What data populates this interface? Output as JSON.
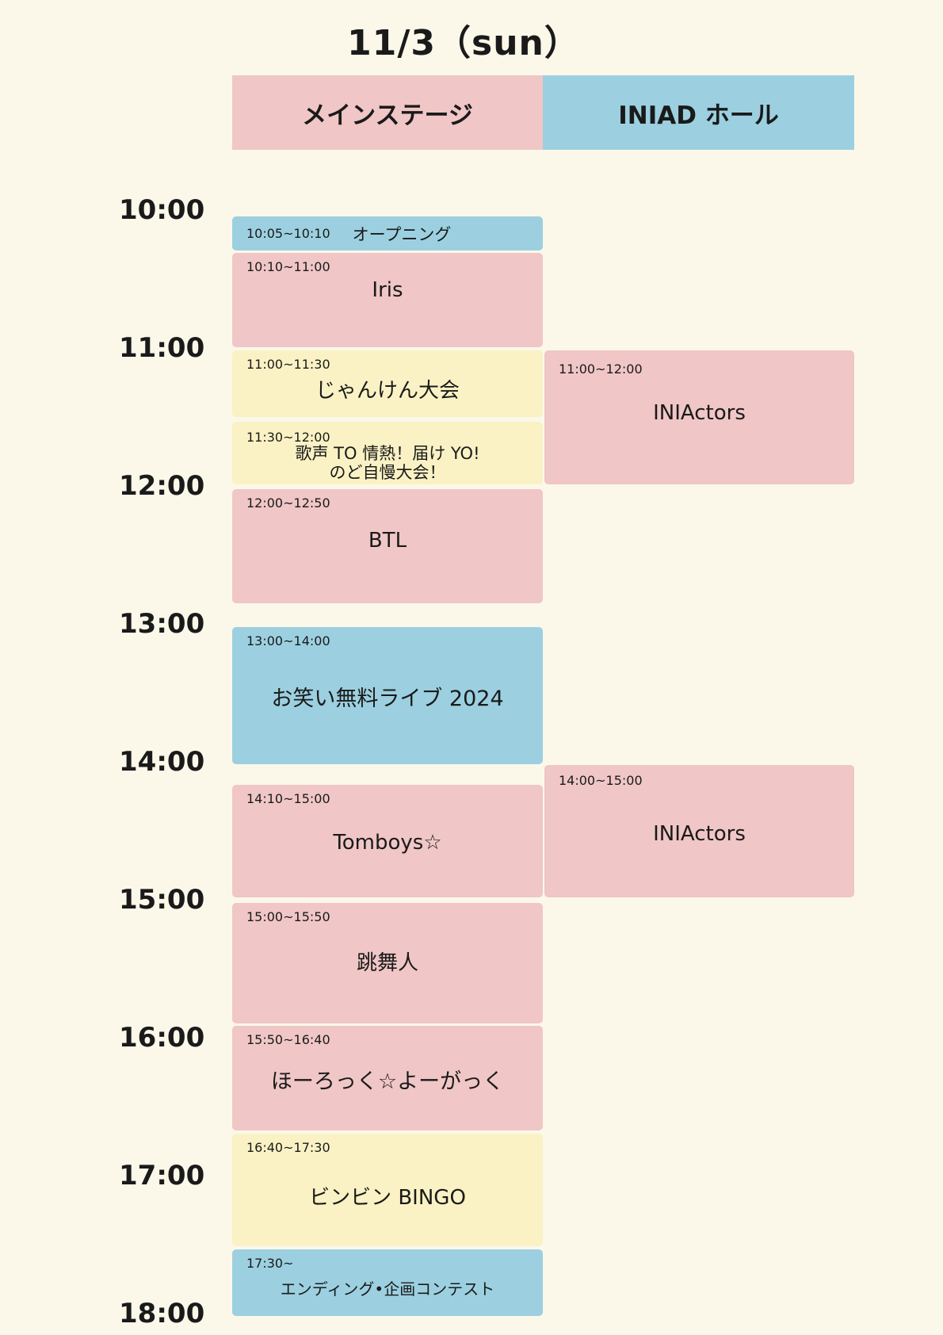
{
  "title": "11/3（sun）",
  "colors": {
    "background": "#fbf8ea",
    "pink": "#f0c6c6",
    "blue": "#9cd0e0",
    "yellow": "#faf2c4"
  },
  "stages": [
    {
      "name": "メインステージ",
      "color": "#f0c6c6"
    },
    {
      "name": "INIAD ホール",
      "color": "#9cd0e0"
    }
  ],
  "hours": [
    "10:00",
    "11:00",
    "12:00",
    "13:00",
    "14:00",
    "15:00",
    "16:00",
    "17:00",
    "18:00"
  ],
  "events": [
    {
      "time": "10:05~10:10",
      "name": "オープニング"
    },
    {
      "time": "10:10~11:00",
      "name": "Iris"
    },
    {
      "time": "11:00~11:30",
      "name": "じゃんけん大会"
    },
    {
      "time": "11:30~12:00",
      "name": "歌声 TO 情熱！届け YO!\nのど自慢大会！"
    },
    {
      "time": "12:00~12:50",
      "name": "BTL"
    },
    {
      "time": "13:00~14:00",
      "name": "お笑い無料ライブ 2024"
    },
    {
      "time": "14:10~15:00",
      "name": "Tomboys☆"
    },
    {
      "time": "15:00~15:50",
      "name": "跳舞人"
    },
    {
      "time": "15:50~16:40",
      "name": "ほーろっく☆よーがっく"
    },
    {
      "time": "16:40~17:30",
      "name": "ビンビン BINGO"
    },
    {
      "time": "17:30~",
      "name": "エンディング•企画コンテスト"
    },
    {
      "time": "11:00~12:00",
      "name": "INIActors"
    },
    {
      "time": "14:00~15:00",
      "name": "INIActors"
    }
  ]
}
